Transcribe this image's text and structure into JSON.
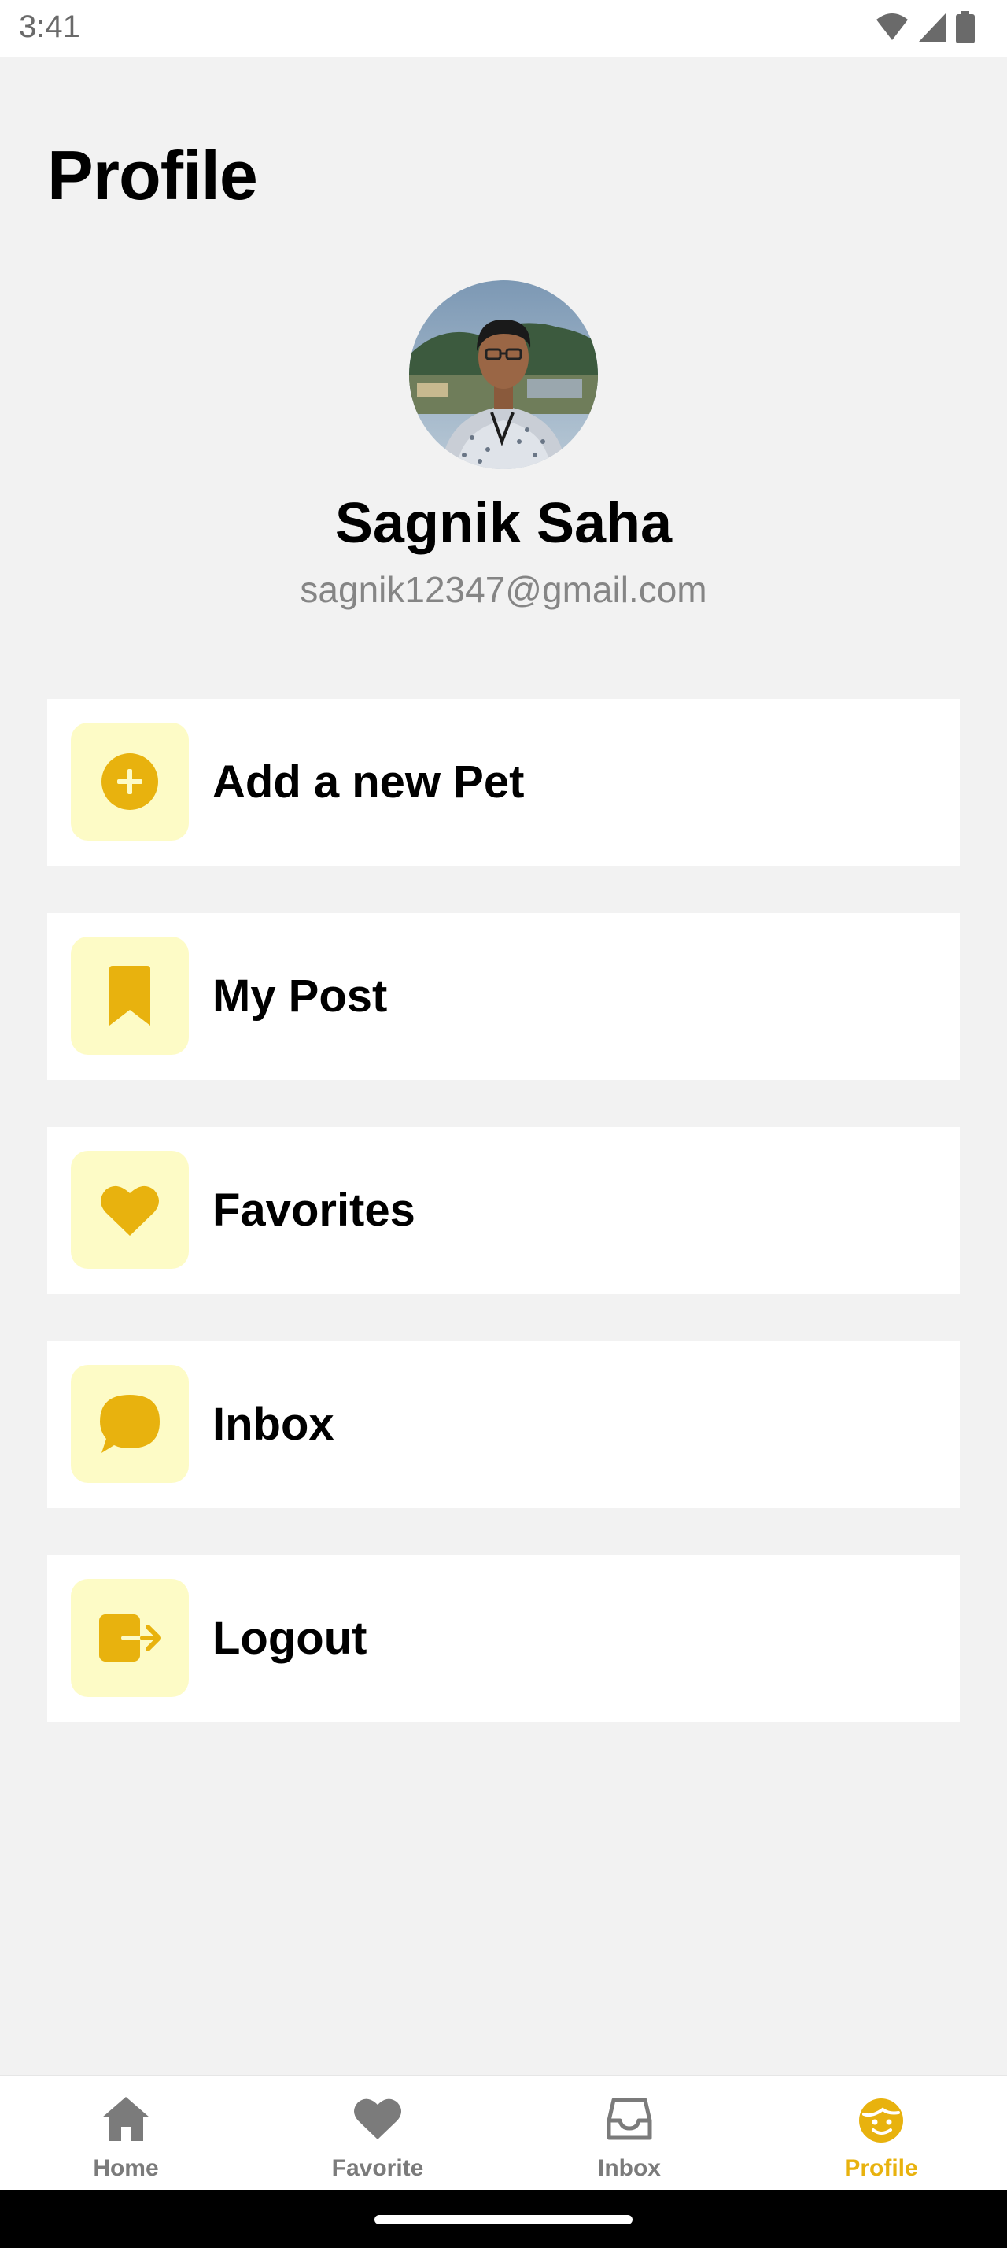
{
  "status_bar": {
    "time": "3:41",
    "icons": [
      "wifi-icon",
      "signal-icon",
      "battery-icon"
    ]
  },
  "page": {
    "title": "Profile"
  },
  "user": {
    "name": "Sagnik Saha",
    "email": "sagnik12347@gmail.com"
  },
  "colors": {
    "accent": "#e8b20e",
    "icon_bg": "#fdfbc6",
    "background": "#f2f2f2",
    "inactive_nav": "#7b7b7b"
  },
  "menu": {
    "items": [
      {
        "label": "Add a new Pet",
        "icon": "add-circle-icon"
      },
      {
        "label": "My Post",
        "icon": "bookmark-icon"
      },
      {
        "label": "Favorites",
        "icon": "heart-icon"
      },
      {
        "label": "Inbox",
        "icon": "chat-bubble-icon"
      },
      {
        "label": "Logout",
        "icon": "logout-icon"
      }
    ]
  },
  "bottom_nav": {
    "items": [
      {
        "label": "Home",
        "icon": "home-icon",
        "active": false
      },
      {
        "label": "Favorite",
        "icon": "heart-icon",
        "active": false
      },
      {
        "label": "Inbox",
        "icon": "inbox-icon",
        "active": false
      },
      {
        "label": "Profile",
        "icon": "profile-face-icon",
        "active": true
      }
    ]
  }
}
